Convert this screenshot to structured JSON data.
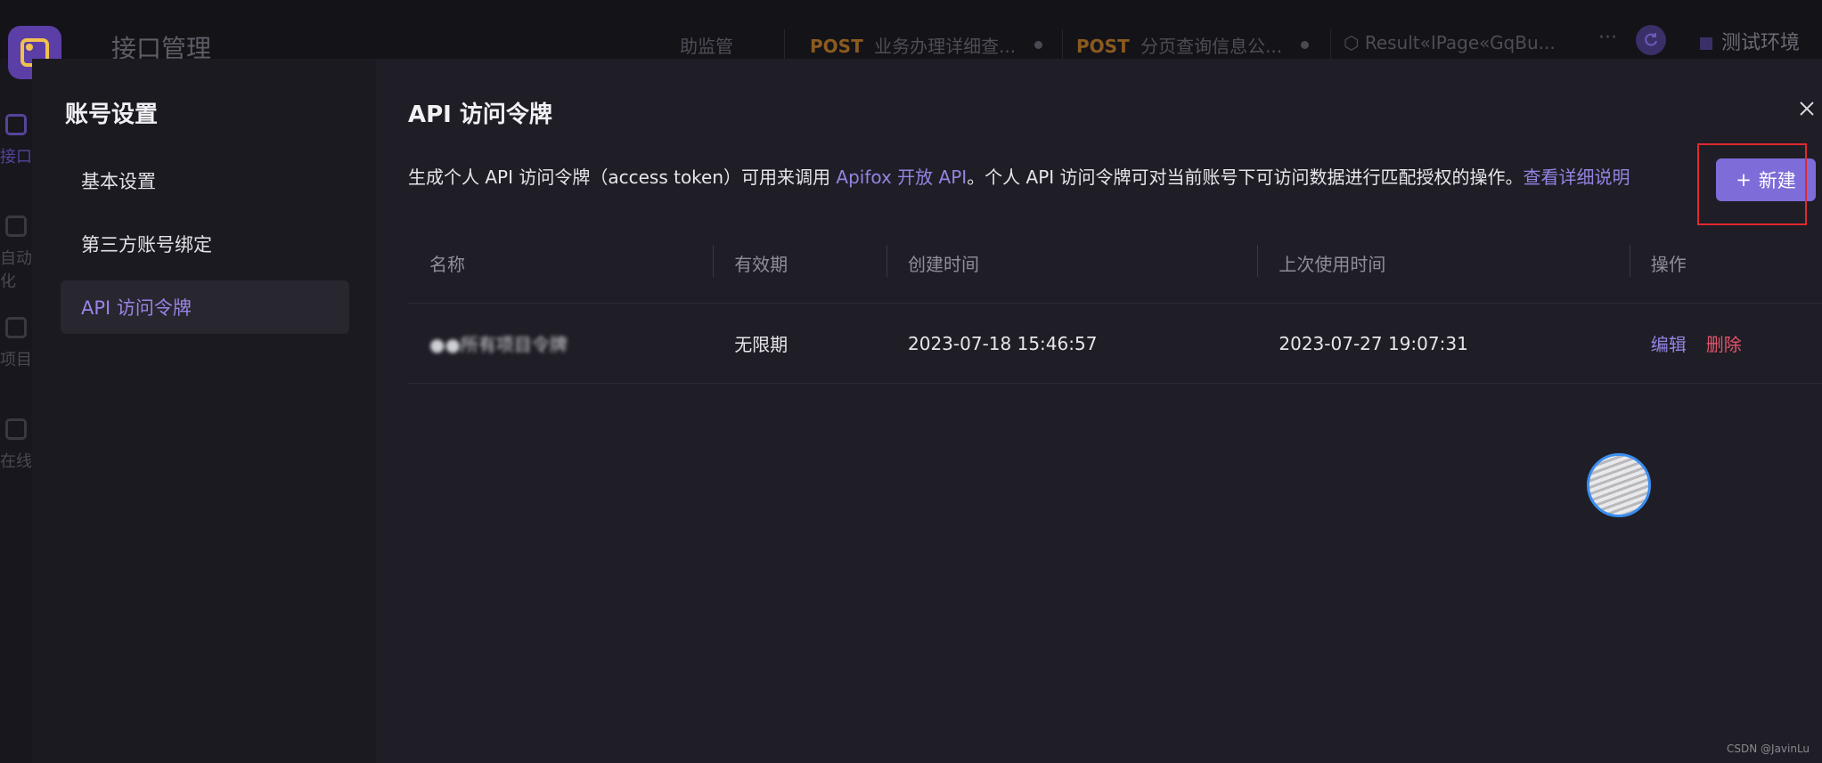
{
  "background": {
    "app_title": "接口管理",
    "tabs": [
      {
        "method": "",
        "label": "助监管"
      },
      {
        "method": "POST",
        "label": "业务办理详细查..."
      },
      {
        "method": "POST",
        "label": "分页查询信息公..."
      },
      {
        "method": "",
        "label": "Result«IPage«GqBu..."
      }
    ],
    "more_label": "···",
    "env_label": "测试环境",
    "sidebar": [
      {
        "label": "接口",
        "active": true
      },
      {
        "label": "自动化",
        "active": false
      },
      {
        "label": "项目",
        "active": false
      },
      {
        "label": "在线",
        "active": false
      }
    ]
  },
  "modal": {
    "left_title": "账号设置",
    "nav": [
      {
        "label": "基本设置",
        "active": false
      },
      {
        "label": "第三方账号绑定",
        "active": false
      },
      {
        "label": "API 访问令牌",
        "active": true
      }
    ],
    "content_title": "API 访问令牌",
    "description": {
      "part1": "生成个人 API 访问令牌（access token）可用来调用 ",
      "link1": "Apifox 开放 API",
      "part2": "。个人 API 访问令牌可对当前账号下可访问数据进行匹配授权的操作。",
      "link2": "查看详细说明"
    },
    "new_button": {
      "icon": "+",
      "label": "新建"
    },
    "table": {
      "headers": [
        "名称",
        "有效期",
        "创建时间",
        "上次使用时间",
        "操作"
      ],
      "rows": [
        {
          "name": "●●所有项目令牌",
          "validity": "无限期",
          "created": "2023-07-18 15:46:57",
          "last_used": "2023-07-27 19:07:31",
          "edit_label": "编辑",
          "delete_label": "删除"
        }
      ]
    }
  },
  "watermark": "CSDN @JavinLu",
  "colors": {
    "accent": "#7e6cd8",
    "link": "#9583e1",
    "danger": "#e2536a",
    "highlight": "#e0292e"
  }
}
